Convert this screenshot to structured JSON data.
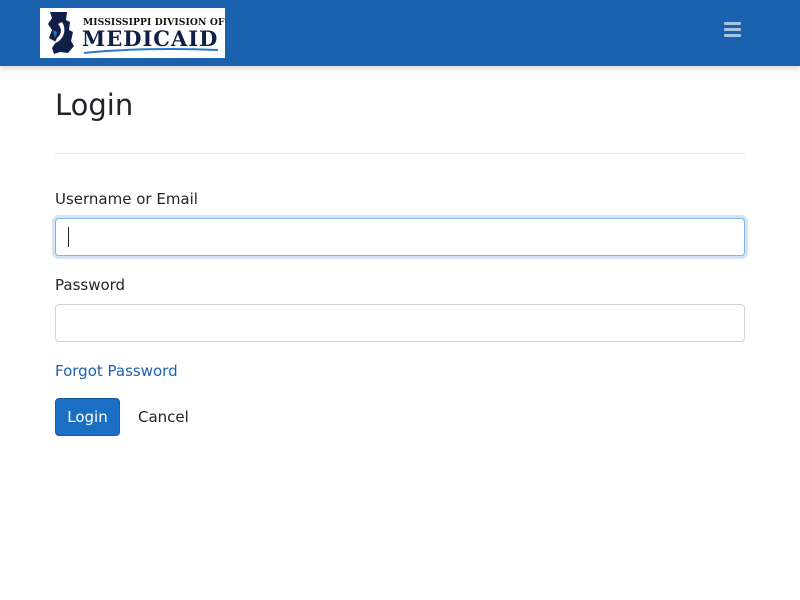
{
  "header": {
    "logo": {
      "top_text": "MISSISSIPPI DIVISION OF",
      "main_text": "MEDICAID",
      "icon": "mississippi-state-icon"
    },
    "menu_icon": "hamburger-icon",
    "background_color": "#1b62ae"
  },
  "main": {
    "title": "Login",
    "username": {
      "label": "Username or Email",
      "value": "",
      "placeholder": ""
    },
    "password": {
      "label": "Password",
      "value": "",
      "placeholder": ""
    },
    "forgot_password_label": "Forgot Password",
    "login_label": "Login",
    "cancel_label": "Cancel"
  },
  "colors": {
    "primary": "#1b6fc2",
    "link": "#1b62ae"
  }
}
